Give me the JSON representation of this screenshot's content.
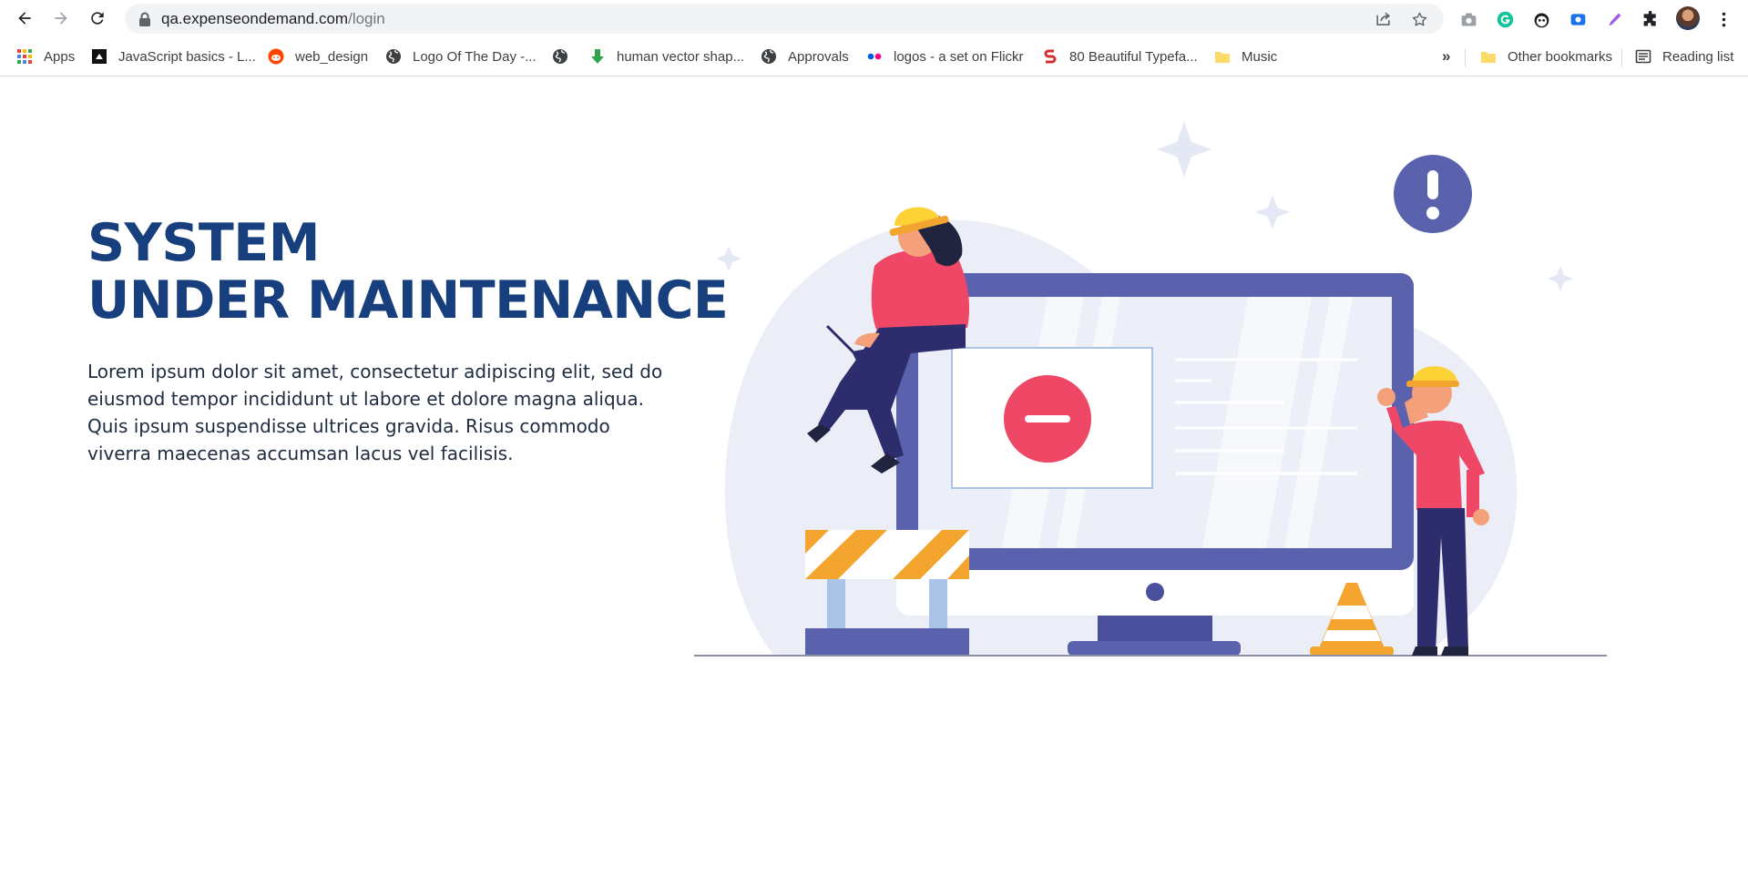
{
  "browser": {
    "url_host": "qa.expenseondemand.com",
    "url_path": "/login",
    "toolbar_icons": [
      "back-icon",
      "forward-icon",
      "reload-icon",
      "lock-icon",
      "share-icon",
      "star-icon"
    ],
    "extensions": [
      "camera-icon",
      "grammarly-icon",
      "panda-icon",
      "screen-record-icon",
      "pen-icon",
      "puzzle-icon",
      "avatar",
      "kebab-menu-icon"
    ]
  },
  "bookmarks": {
    "items": [
      {
        "label": "Apps",
        "icon": "apps-grid-icon"
      },
      {
        "label": "JavaScript basics - L...",
        "icon": "black-square-icon"
      },
      {
        "label": "web_design",
        "icon": "reddit-icon"
      },
      {
        "label": "Logo Of The Day -...",
        "icon": "globe-icon"
      },
      {
        "label": "",
        "icon": "globe-icon"
      },
      {
        "label": "human vector shap...",
        "icon": "download-arrow-icon"
      },
      {
        "label": "Approvals",
        "icon": "globe-icon"
      },
      {
        "label": "logos - a set on Flickr",
        "icon": "flickr-icon"
      },
      {
        "label": "80 Beautiful Typefa...",
        "icon": "s-logo-icon"
      },
      {
        "label": "Music",
        "icon": "folder-icon"
      }
    ],
    "overflow": "»",
    "other": {
      "label": "Other bookmarks",
      "icon": "folder-icon"
    },
    "reading_list": {
      "label": "Reading list",
      "icon": "reading-list-icon"
    }
  },
  "page": {
    "heading_line1": "SYSTEM",
    "heading_line2": "UNDER MAINTENANCE",
    "description": "Lorem ipsum dolor sit amet, consectetur adipiscing elit, sed do eiusmod tempor incididunt ut labore et dolore magna aliqua. Quis ipsum suspendisse ultrices gravida. Risus commodo viverra maecenas accumsan lacus vel facilisis."
  },
  "colors": {
    "heading": "#183f7d",
    "monitor": "#5b62ad",
    "accent_red": "#ef4766",
    "helmet_yellow": "#fdd236",
    "barrier_orange": "#f3a530",
    "background_blob": "#eceef7"
  }
}
